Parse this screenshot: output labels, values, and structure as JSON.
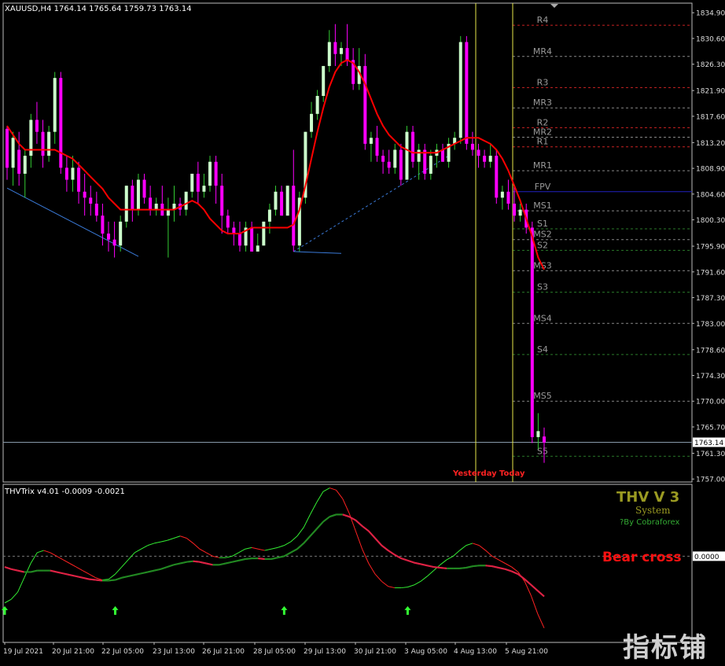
{
  "header": {
    "symbol_info": "XAUUSD,H4  1764.14 1765.64 1759.73 1763.14",
    "sub_info": "THVTrix v4.01 -0.0009 -0.0021"
  },
  "brand": {
    "title": "THV V 3",
    "system": "System",
    "credit": "?By Cobraforex",
    "watermark": "指标铺"
  },
  "colors": {
    "bull": "#ccffcc",
    "bear": "#ff00ff",
    "ma": "#ff0000",
    "trix_fast": "#33ee33",
    "trix_slow": "#228822",
    "pivot_red": "#cc2222",
    "pivot_gray": "#888888",
    "pivot_green": "#2a7a2a",
    "fpv": "#2020c0",
    "vline": "#e8e84a",
    "bear_cross": "#ff1111"
  },
  "annotations": {
    "yesterday": "Yesterday",
    "today": "Today",
    "bear_cross": "Bear cross",
    "current_price": "1763.14"
  },
  "chart_data": [
    {
      "type": "candlestick",
      "title": "XAUUSD,H4",
      "ylim": [
        1756.5,
        1836.5
      ],
      "y_ticks": [
        "1834.90",
        "1830.60",
        "1826.30",
        "1821.90",
        "1817.60",
        "1813.20",
        "1808.90",
        "1804.60",
        "1800.30",
        "1795.90",
        "1791.60",
        "1787.30",
        "1783.00",
        "1778.60",
        "1774.30",
        "1770.00",
        "1765.70",
        "1761.30",
        "1757.00"
      ],
      "x_ticks": [
        "19 Jul 2021",
        "20 Jul 21:00",
        "22 Jul 05:00",
        "23 Jul 13:00",
        "26 Jul 21:00",
        "28 Jul 05:00",
        "29 Jul 13:00",
        "30 Jul 21:00",
        "3 Aug 05:00",
        "4 Aug 13:00",
        "5 Aug 21:00"
      ],
      "candles": [
        [
          1815.5,
          1816,
          1807,
          1809
        ],
        [
          1809,
          1815,
          1806,
          1814
        ],
        [
          1812,
          1815,
          1806,
          1808
        ],
        [
          1808,
          1812,
          1804,
          1811
        ],
        [
          1811,
          1818,
          1809,
          1817
        ],
        [
          1817,
          1820,
          1813,
          1815
        ],
        [
          1815,
          1817,
          1809,
          1811
        ],
        [
          1811,
          1816,
          1810,
          1815
        ],
        [
          1815,
          1825,
          1813,
          1824
        ],
        [
          1824,
          1825,
          1808,
          1809
        ],
        [
          1809,
          1811,
          1805,
          1807
        ],
        [
          1807,
          1811,
          1805,
          1809
        ],
        [
          1809,
          1810,
          1803,
          1805
        ],
        [
          1805,
          1808,
          1801,
          1804
        ],
        [
          1804,
          1806,
          1801,
          1803
        ],
        [
          1803,
          1805,
          1800,
          1801
        ],
        [
          1801,
          1803,
          1796,
          1798
        ],
        [
          1798,
          1800,
          1795,
          1797
        ],
        [
          1797,
          1800,
          1794,
          1796
        ],
        [
          1796,
          1801,
          1795,
          1800
        ],
        [
          1800,
          1806,
          1799,
          1806
        ],
        [
          1806,
          1807,
          1800,
          1802
        ],
        [
          1802,
          1808,
          1801,
          1807
        ],
        [
          1807,
          1808,
          1803,
          1804
        ],
        [
          1804,
          1806,
          1801,
          1802
        ],
        [
          1802,
          1804,
          1801,
          1803
        ],
        [
          1803,
          1806,
          1801,
          1801
        ],
        [
          1801,
          1804,
          1794,
          1802
        ],
        [
          1802,
          1806,
          1800,
          1803
        ],
        [
          1803,
          1804,
          1801,
          1802
        ],
        [
          1802,
          1805,
          1801,
          1805
        ],
        [
          1805,
          1808,
          1804,
          1808
        ],
        [
          1808,
          1810,
          1803,
          1805
        ],
        [
          1805,
          1808,
          1804,
          1806
        ],
        [
          1806,
          1811,
          1805,
          1810
        ],
        [
          1810,
          1811,
          1803,
          1806
        ],
        [
          1806,
          1808,
          1798,
          1801
        ],
        [
          1801,
          1802,
          1798,
          1799
        ],
        [
          1799,
          1800,
          1796,
          1798
        ],
        [
          1798,
          1800,
          1795,
          1796
        ],
        [
          1796,
          1800,
          1795,
          1799
        ],
        [
          1799,
          1800,
          1795,
          1795
        ],
        [
          1795,
          1798,
          1795,
          1796
        ],
        [
          1796,
          1800,
          1796,
          1800
        ],
        [
          1800,
          1803,
          1798,
          1802
        ],
        [
          1802,
          1806,
          1801,
          1805
        ],
        [
          1805,
          1806,
          1801,
          1801
        ],
        [
          1801,
          1806,
          1801,
          1806
        ],
        [
          1806,
          1812,
          1795,
          1796
        ],
        [
          1796,
          1805,
          1795,
          1804
        ],
        [
          1804,
          1815,
          1803,
          1815
        ],
        [
          1815,
          1820,
          1814,
          1818
        ],
        [
          1818,
          1822,
          1817,
          1821
        ],
        [
          1821,
          1826,
          1820,
          1826
        ],
        [
          1826,
          1832,
          1825,
          1830
        ],
        [
          1830,
          1833,
          1826,
          1828
        ],
        [
          1828,
          1830,
          1826,
          1829
        ],
        [
          1829,
          1833,
          1826,
          1827
        ],
        [
          1827,
          1829,
          1822,
          1823
        ],
        [
          1823,
          1829,
          1822,
          1826
        ],
        [
          1826,
          1828,
          1812,
          1813
        ],
        [
          1813,
          1815,
          1810,
          1814
        ],
        [
          1814,
          1816,
          1810,
          1811
        ],
        [
          1811,
          1812,
          1808,
          1810
        ],
        [
          1810,
          1812,
          1808,
          1809
        ],
        [
          1809,
          1813,
          1808,
          1812
        ],
        [
          1812,
          1813,
          1806,
          1807
        ],
        [
          1807,
          1816,
          1807,
          1815
        ],
        [
          1815,
          1816,
          1809,
          1810
        ],
        [
          1810,
          1813,
          1807,
          1812
        ],
        [
          1812,
          1813,
          1807,
          1808
        ],
        [
          1808,
          1812,
          1807,
          1811
        ],
        [
          1811,
          1813,
          1809,
          1812
        ],
        [
          1812,
          1813,
          1810,
          1810
        ],
        [
          1810,
          1814,
          1809,
          1813
        ],
        [
          1813,
          1815,
          1812,
          1814
        ],
        [
          1814,
          1831,
          1813,
          1830
        ],
        [
          1830,
          1831,
          1812,
          1813
        ],
        [
          1813,
          1815,
          1811,
          1812
        ],
        [
          1812,
          1813,
          1809,
          1811
        ],
        [
          1811,
          1812,
          1809,
          1810
        ],
        [
          1810,
          1813,
          1809,
          1811
        ],
        [
          1811,
          1812,
          1803,
          1804
        ],
        [
          1804,
          1806,
          1802,
          1805
        ],
        [
          1805,
          1807,
          1802,
          1803
        ],
        [
          1803,
          1806,
          1800,
          1801
        ],
        [
          1801,
          1803,
          1800,
          1802
        ],
        [
          1802,
          1803,
          1798,
          1799
        ],
        [
          1799,
          1800,
          1763,
          1764
        ],
        [
          1764,
          1768,
          1762,
          1765
        ],
        [
          1764.1,
          1765.6,
          1759.7,
          1763.1
        ]
      ],
      "ma": [
        1816,
        1814.5,
        1813,
        1812,
        1812,
        1812,
        1812,
        1812,
        1812,
        1811.5,
        1811,
        1810.5,
        1809.5,
        1808.5,
        1807.5,
        1806.5,
        1805.5,
        1804,
        1803,
        1802,
        1802,
        1802,
        1802,
        1802,
        1802,
        1802,
        1802,
        1802,
        1802,
        1802.5,
        1803,
        1803.5,
        1803,
        1802,
        1800.5,
        1799.5,
        1798.5,
        1798,
        1798,
        1798,
        1798.5,
        1799,
        1799,
        1799,
        1799,
        1799,
        1799,
        1799,
        1799.5,
        1802,
        1806,
        1810.5,
        1815,
        1819,
        1822.5,
        1825,
        1826.5,
        1827,
        1826.5,
        1825,
        1823,
        1820.5,
        1818,
        1816,
        1814.5,
        1813.5,
        1812.5,
        1812,
        1811.5,
        1811.5,
        1811.5,
        1811.5,
        1811.5,
        1812,
        1812.5,
        1813,
        1813.5,
        1814,
        1814,
        1814,
        1813.5,
        1813,
        1812,
        1810.5,
        1808.5,
        1806,
        1803.5,
        1800.5,
        1797.5,
        1794,
        1792
      ],
      "pivots": [
        {
          "label": "R4",
          "value": 1832.8,
          "style": "red"
        },
        {
          "label": "MR4",
          "value": 1827.6,
          "style": "gray"
        },
        {
          "label": "R3",
          "value": 1822.4,
          "style": "red"
        },
        {
          "label": "MR3",
          "value": 1819.0,
          "style": "gray"
        },
        {
          "label": "R2",
          "value": 1815.7,
          "style": "red"
        },
        {
          "label": "MR2",
          "value": 1814.1,
          "style": "gray"
        },
        {
          "label": "R1",
          "value": 1812.5,
          "style": "red"
        },
        {
          "label": "MR1",
          "value": 1808.5,
          "style": "gray"
        },
        {
          "label": "FPV",
          "value": 1805.0,
          "style": "fpv"
        },
        {
          "label": "MS1",
          "value": 1801.8,
          "style": "gray"
        },
        {
          "label": "S1",
          "value": 1798.8,
          "style": "green"
        },
        {
          "label": "MS2",
          "value": 1797.0,
          "style": "gray"
        },
        {
          "label": "S2",
          "value": 1795.2,
          "style": "green"
        },
        {
          "label": "MS3",
          "value": 1791.8,
          "style": "gray"
        },
        {
          "label": "S3",
          "value": 1788.2,
          "style": "green"
        },
        {
          "label": "MS4",
          "value": 1783.0,
          "style": "gray"
        },
        {
          "label": "S4",
          "value": 1777.8,
          "style": "green"
        },
        {
          "label": "MS5",
          "value": 1770.0,
          "style": "gray"
        },
        {
          "label": "S5",
          "value": 1760.8,
          "style": "green"
        }
      ],
      "current_price": 1763.14
    },
    {
      "type": "line",
      "title": "THVTrix v4.01",
      "y_ticks": [
        "0.0000"
      ],
      "ylim": [
        -0.012,
        0.01
      ],
      "series": [
        {
          "values": [
            -0.0065,
            -0.006,
            -0.005,
            -0.003,
            -0.001,
            0.0005,
            0.0008,
            0.0005,
            0.0,
            -0.0005,
            -0.001,
            -0.0015,
            -0.002,
            -0.0025,
            -0.003,
            -0.0033,
            -0.0032,
            -0.0025,
            -0.0015,
            -0.0005,
            0.0005,
            0.001,
            0.0015,
            0.0018,
            0.002,
            0.0022,
            0.0025,
            0.0028,
            0.0025,
            0.0018,
            0.001,
            0.0005,
            0.0,
            -0.0002,
            -0.0002,
            0.0,
            0.0005,
            0.001,
            0.0012,
            0.001,
            0.0008,
            0.001,
            0.0012,
            0.0015,
            0.002,
            0.0028,
            0.004,
            0.0058,
            0.0075,
            0.009,
            0.0095,
            0.0092,
            0.008,
            0.006,
            0.0035,
            0.001,
            -0.001,
            -0.0025,
            -0.0035,
            -0.0042,
            -0.0044,
            -0.0044,
            -0.0043,
            -0.004,
            -0.0035,
            -0.0028,
            -0.002,
            -0.0012,
            -0.0005,
            0.0,
            0.0008,
            0.0015,
            0.0018,
            0.0015,
            0.0008,
            0.0,
            -0.0005,
            -0.001,
            -0.0015,
            -0.0022,
            -0.0035,
            -0.0055,
            -0.008,
            -0.01
          ]
        },
        {
          "values": [
            -0.0015,
            -0.0018,
            -0.002,
            -0.0022,
            -0.0022,
            -0.002,
            -0.002,
            -0.002,
            -0.0022,
            -0.0024,
            -0.0026,
            -0.0028,
            -0.003,
            -0.0032,
            -0.0033,
            -0.0034,
            -0.0034,
            -0.0033,
            -0.003,
            -0.0028,
            -0.0026,
            -0.0024,
            -0.0022,
            -0.002,
            -0.0018,
            -0.0015,
            -0.0012,
            -0.001,
            -0.0008,
            -0.0007,
            -0.0008,
            -0.001,
            -0.0012,
            -0.0012,
            -0.001,
            -0.0008,
            -0.0006,
            -0.0004,
            -0.0003,
            -0.0003,
            -0.0004,
            -0.0004,
            -0.0002,
            0.0,
            0.0005,
            0.001,
            0.0018,
            0.0028,
            0.0038,
            0.0048,
            0.0055,
            0.0058,
            0.0058,
            0.0055,
            0.005,
            0.0042,
            0.0035,
            0.0025,
            0.0015,
            0.0008,
            0.0002,
            -0.0003,
            -0.0006,
            -0.0009,
            -0.0011,
            -0.0013,
            -0.0015,
            -0.0016,
            -0.0017,
            -0.0017,
            -0.0017,
            -0.0016,
            -0.0014,
            -0.0013,
            -0.0013,
            -0.0014,
            -0.0016,
            -0.0018,
            -0.0021,
            -0.0025,
            -0.0032,
            -0.004,
            -0.0048,
            -0.0056
          ]
        },
        {
          "values": [
            -0.0015,
            -0.0018,
            -0.002,
            -0.0022,
            -0.0022,
            -0.002,
            -0.002,
            -0.002,
            -0.0022,
            -0.0024,
            -0.0026,
            -0.0028,
            -0.003,
            -0.0032,
            -0.0033,
            -0.0034,
            -0.0034,
            -0.0033,
            -0.003,
            -0.0028,
            -0.0026,
            -0.0024,
            -0.0022,
            -0.002,
            -0.0018,
            -0.0015,
            -0.0012,
            -0.001,
            -0.0008,
            -0.0007,
            -0.0008,
            -0.001,
            -0.0012,
            -0.0012,
            -0.001,
            -0.0008,
            -0.0006,
            -0.0004,
            -0.0003,
            -0.0003,
            -0.0004,
            -0.0004,
            -0.0002,
            0.0,
            0.0005,
            0.001,
            0.0018,
            0.0028,
            0.0038,
            0.0048,
            0.0055,
            0.0058,
            0.0058,
            0.0055,
            0.005,
            0.0042,
            0.0035,
            0.0025,
            0.0015,
            0.0008,
            0.0002,
            -0.0003,
            -0.0006,
            -0.0009,
            -0.0011,
            -0.0013,
            -0.0015,
            -0.0016,
            -0.0017,
            -0.0017,
            -0.0017,
            -0.0016,
            -0.0014,
            -0.0013,
            -0.0013,
            -0.0014,
            -0.0016,
            -0.0018,
            -0.0021,
            -0.0025,
            -0.0032,
            -0.004,
            -0.0048,
            -0.0056
          ]
        }
      ]
    }
  ]
}
